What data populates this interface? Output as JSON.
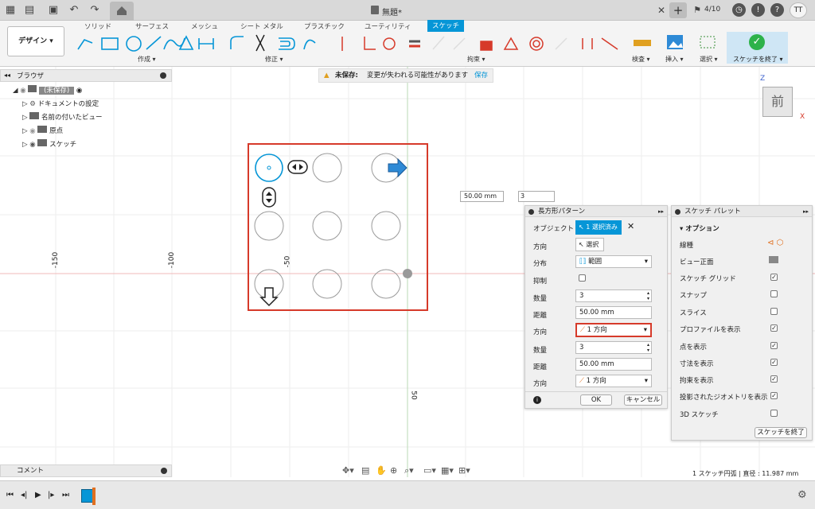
{
  "app": {
    "title": "無題*",
    "job_count": "4/10",
    "user_initials": "TT"
  },
  "ribbon": {
    "workspace": "デザイン",
    "tabs": [
      "ソリッド",
      "サーフェス",
      "メッシュ",
      "シート メタル",
      "プラスチック",
      "ユーティリティ",
      "スケッチ"
    ],
    "groups": {
      "create": "作成",
      "modify": "修正",
      "constraints": "拘束",
      "inspect": "検査",
      "insert": "挿入",
      "select": "選択",
      "finish": "スケッチを終了"
    }
  },
  "browser": {
    "title": "ブラウザ",
    "items": [
      "(未保存)",
      "ドキュメントの設定",
      "名前の付いたビュー",
      "原点",
      "スケッチ"
    ]
  },
  "warning": {
    "label": "未保存:",
    "message": "変更が失われる可能性があります",
    "save": "保存"
  },
  "viewcube": {
    "face": "前",
    "axis_z": "Z",
    "axis_x": "X"
  },
  "rulers": {
    "h1": "-150",
    "h2": "-100",
    "h3": "-50",
    "v1": "50"
  },
  "inline_input": {
    "distance": "50.00 mm",
    "count": "3"
  },
  "pattern": {
    "title": "長方形パターン",
    "objects_label": "オブジェクト",
    "objects_value": "1 選択済み",
    "dir1_label": "方向",
    "select": "選択",
    "dist_label": "分布",
    "dist_value": "範囲",
    "suppress_label": "抑制",
    "qty1_label": "数量",
    "qty1": "3",
    "distance1_label": "距離",
    "distance1": "50.00 mm",
    "direction1_label": "方向",
    "direction1": "1 方向",
    "qty2_label": "数量",
    "qty2": "3",
    "distance2_label": "距離",
    "distance2": "50.00 mm",
    "direction2_label": "方向",
    "direction2": "1 方向",
    "ok": "OK",
    "cancel": "キャンセル"
  },
  "palette": {
    "title": "スケッチ パレット",
    "options": "オプション",
    "rows": [
      {
        "label": "線種"
      },
      {
        "label": "ビュー正面"
      },
      {
        "label": "スケッチ グリッド",
        "checked": true
      },
      {
        "label": "スナップ",
        "checked": false
      },
      {
        "label": "スライス",
        "checked": false
      },
      {
        "label": "プロファイルを表示",
        "checked": true
      },
      {
        "label": "点を表示",
        "checked": true
      },
      {
        "label": "寸法を表示",
        "checked": true
      },
      {
        "label": "拘束を表示",
        "checked": true
      },
      {
        "label": "投影されたジオメトリを表示",
        "checked": true
      },
      {
        "label": "3D スケッチ",
        "checked": false
      }
    ],
    "finish": "スケッチを終了"
  },
  "comment": "コメント",
  "status": "1 スケッチ円弧 | 直径 : 11.987 mm",
  "colors": {
    "accent": "#0696d7",
    "highlight": "#d63a2a",
    "finish_green": "#2db24a"
  }
}
